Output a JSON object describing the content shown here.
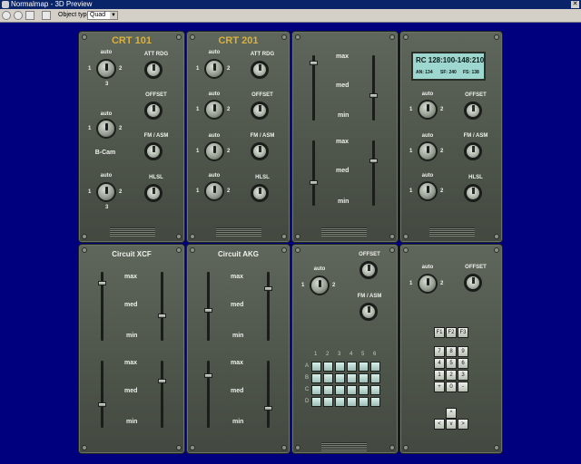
{
  "window": {
    "title": "Normalmap - 3D Preview"
  },
  "toolbar": {
    "object_type_label": "Object type",
    "object_type_value": "Quad"
  },
  "crt101": {
    "title": "CRT 101",
    "knob_label": "auto",
    "mid_label": "B-Cam",
    "att": "ATT RDG",
    "offset": "OFFSET",
    "fm": "FM / ASM",
    "hlsl": "HLSL"
  },
  "crt201": {
    "title": "CRT 201",
    "knob_label": "auto",
    "att": "ATT RDG",
    "offset": "OFFSET",
    "fm": "FM / ASM",
    "hlsl": "HLSL"
  },
  "faders": {
    "max": "max",
    "med": "med",
    "min": "min"
  },
  "rc": {
    "display_main": "RC 128:100-148:210",
    "an": "AN: 134",
    "sf": "SF: 240",
    "fs": "FS: 138",
    "knob_label": "auto",
    "offset": "OFFSET",
    "fm": "FM / ASM",
    "hlsl": "HLSL"
  },
  "xcf": {
    "title": "Circuit XCF"
  },
  "akg": {
    "title": "Circuit AKG"
  },
  "pad": {
    "knob_label": "auto",
    "offset": "OFFSET",
    "fm": "FM / ASM",
    "cols": [
      "1",
      "2",
      "3",
      "4",
      "5",
      "6"
    ],
    "rows": [
      "A",
      "B",
      "C",
      "D"
    ]
  },
  "keypad": {
    "knob_label": "auto",
    "offset": "OFFSET",
    "fkeys": [
      "F1",
      "F2",
      "F3"
    ],
    "keys": [
      "7",
      "8",
      "9",
      "4",
      "5",
      "6",
      "1",
      "2",
      "3",
      "+",
      "0",
      "-"
    ],
    "arrows": {
      "up": "^",
      "left": "<",
      "down": "v",
      "right": ">"
    }
  },
  "scale": {
    "one": "1",
    "two": "2",
    "three": "3"
  }
}
